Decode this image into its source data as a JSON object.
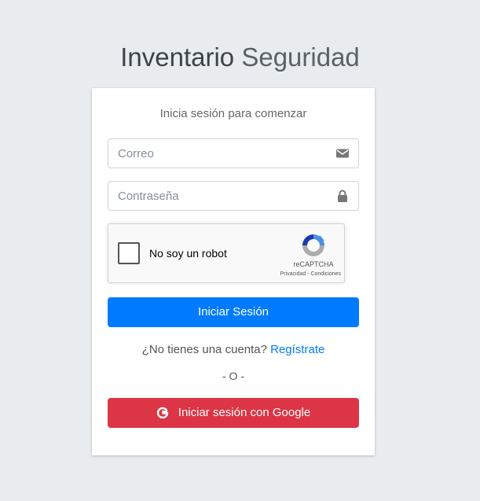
{
  "logo": {
    "bold": "Inventario",
    "light": " Seguridad"
  },
  "login": {
    "message": "Inicia sesión para comenzar",
    "email_placeholder": "Correo",
    "password_placeholder": "Contraseña",
    "email_icon": "envelope-icon",
    "password_icon": "lock-icon"
  },
  "captcha": {
    "label": "No soy un robot",
    "brand": "reCAPTCHA",
    "links": "Privacidad - Condiciones"
  },
  "submit_label": "Iniciar Sesión",
  "register": {
    "prompt": "¿No tienes una cuenta? ",
    "link": "Regístrate"
  },
  "separator": "- O -",
  "google_label": "Iniciar sesión con Google",
  "colors": {
    "primary": "#007bff",
    "danger": "#dc3545",
    "background": "#e9ecef"
  }
}
